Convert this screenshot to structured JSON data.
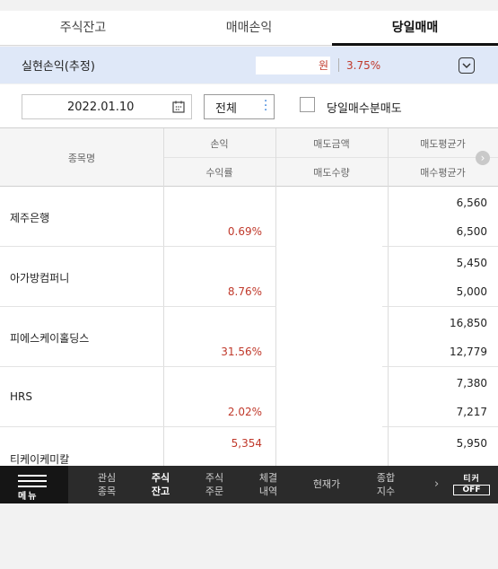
{
  "tabs": [
    "주식잔고",
    "매매손익",
    "당일매매"
  ],
  "summary": {
    "label": "실현손익(추정)",
    "amount_suffix": "원",
    "rate": "3.75%"
  },
  "filter": {
    "date": "2022.01.10",
    "select_value": "전체",
    "checkbox_label": "당일매수분매도"
  },
  "table": {
    "headers": {
      "name": "종목명",
      "profit": "손익",
      "rate": "수익률",
      "sell_amount": "매도금액",
      "sell_qty": "매도수량",
      "sell_avg": "매도평균가",
      "buy_avg": "매수평균가"
    },
    "rows": [
      {
        "name": "제주은행",
        "profit": "",
        "rate": "0.69%",
        "sell_avg": "6,560",
        "buy_avg": "6,500"
      },
      {
        "name": "아가방컴퍼니",
        "profit": "",
        "rate": "8.76%",
        "sell_avg": "5,450",
        "buy_avg": "5,000"
      },
      {
        "name": "피에스케이홀딩스",
        "profit": "",
        "rate": "31.56%",
        "sell_avg": "16,850",
        "buy_avg": "12,779"
      },
      {
        "name": "HRS",
        "profit": "",
        "rate": "2.02%",
        "sell_avg": "7,380",
        "buy_avg": "7,217"
      },
      {
        "name": "티케이케미칼",
        "profit": "5,354",
        "rate": "",
        "sell_avg": "5,950",
        "buy_avg": ""
      }
    ]
  },
  "bottom_nav": {
    "menu": "메뉴",
    "items": [
      "관심\n종목",
      "주식\n잔고",
      "주식\n주문",
      "체결\n내역",
      "현재가",
      "종합\n지수"
    ],
    "ticker_top": "티커",
    "ticker_off": "OFF"
  },
  "colors": {
    "gain": "#c0392b",
    "summary_bg": "#dfe8f8",
    "nav_bg": "#2b2b2b"
  }
}
